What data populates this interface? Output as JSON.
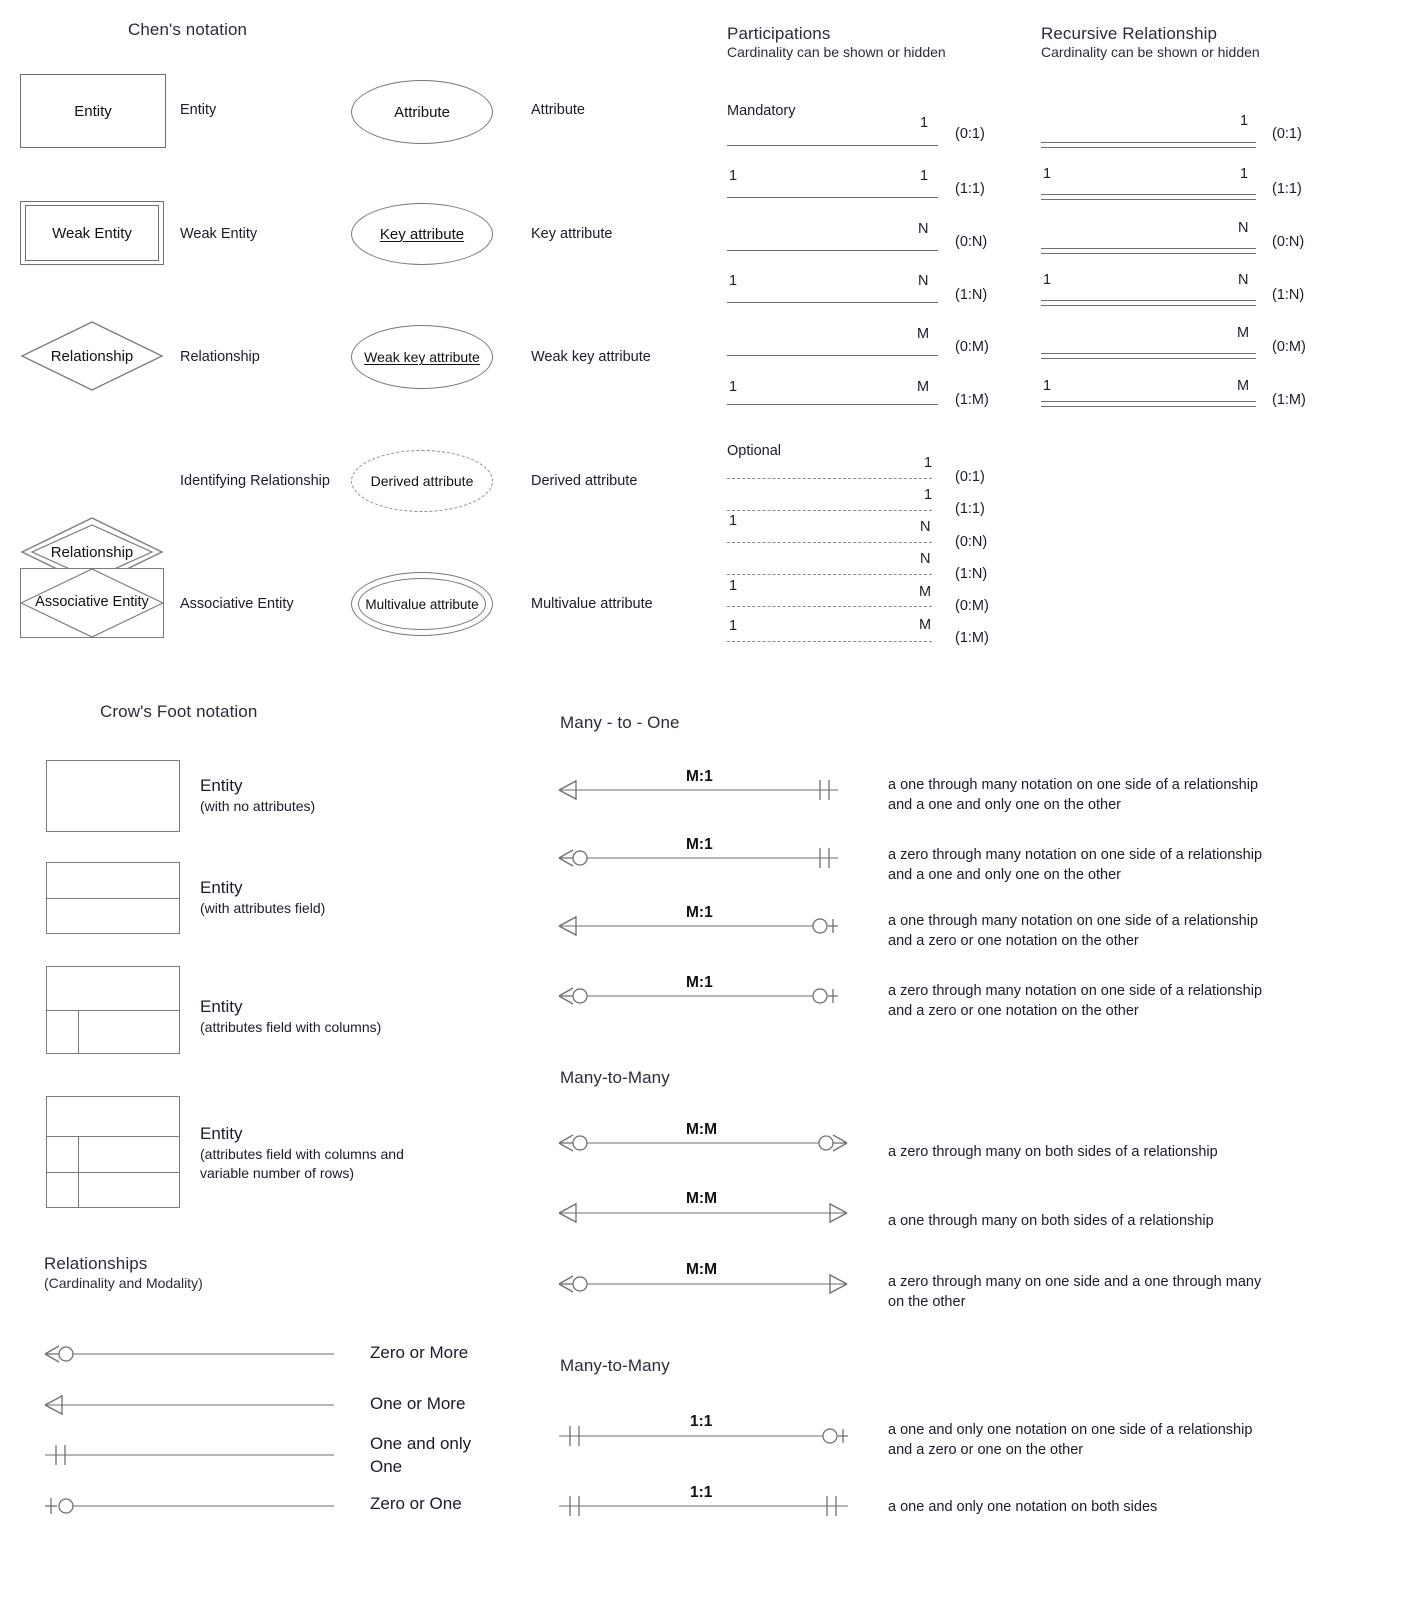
{
  "chen": {
    "title": "Chen's notation",
    "left_items": [
      {
        "shape": "rectangle",
        "shape_text": "Entity",
        "label": "Entity"
      },
      {
        "shape": "double-rectangle",
        "shape_text": "Weak Entity",
        "label": "Weak Entity"
      },
      {
        "shape": "diamond",
        "shape_text": "Relationship",
        "label": "Relationship"
      },
      {
        "shape": "double-diamond",
        "shape_text": "Relationship",
        "label": "Identifying Relationship"
      },
      {
        "shape": "diamond-in-rectangle",
        "shape_text": "Associative Entity",
        "label": "Associative Entity"
      }
    ],
    "right_items": [
      {
        "shape": "ellipse",
        "shape_text": "Attribute",
        "label": "Attribute",
        "underline": false
      },
      {
        "shape": "ellipse",
        "shape_text": "Key attribute",
        "label": "Key attribute",
        "underline": true
      },
      {
        "shape": "ellipse",
        "shape_text": "Weak key attribute",
        "label": "Weak key attribute",
        "underline": true
      },
      {
        "shape": "dashed-ellipse",
        "shape_text": "Derived attribute",
        "label": "Derived attribute",
        "underline": false
      },
      {
        "shape": "double-ellipse",
        "shape_text": "Multivalue attribute",
        "label": "Multivalue attribute",
        "underline": false
      }
    ]
  },
  "participations": {
    "title": "Participations",
    "subtitle": "Cardinality can be shown or hidden",
    "mandatory_label": "Mandatory",
    "optional_label": "Optional",
    "mandatory_rows": [
      {
        "left": "",
        "right": "1",
        "card": "(0:1)"
      },
      {
        "left": "1",
        "right": "1",
        "card": "(1:1)"
      },
      {
        "left": "",
        "right": "N",
        "card": "(0:N)"
      },
      {
        "left": "1",
        "right": "N",
        "card": "(1:N)"
      },
      {
        "left": "",
        "right": "M",
        "card": "(0:M)"
      },
      {
        "left": "1",
        "right": "M",
        "card": "(1:M)"
      }
    ],
    "optional_rows": [
      {
        "left": "",
        "right": "1",
        "card": "(0:1)"
      },
      {
        "left": "",
        "right": "1",
        "card": "(1:1)"
      },
      {
        "left": "1",
        "right": "N",
        "card": "(0:N)"
      },
      {
        "left": "",
        "right": "N",
        "card": "(1:N)"
      },
      {
        "left": "1",
        "right": "M",
        "card": "(0:M)"
      },
      {
        "left": "1",
        "right": "M",
        "card": "(1:M)"
      }
    ]
  },
  "recursive": {
    "title": "Recursive Relationship",
    "subtitle": "Cardinality can be shown or hidden",
    "rows": [
      {
        "left": "",
        "right": "1",
        "card": "(0:1)"
      },
      {
        "left": "1",
        "right": "1",
        "card": "(1:1)"
      },
      {
        "left": "",
        "right": "N",
        "card": "(0:N)"
      },
      {
        "left": "1",
        "right": "N",
        "card": "(1:N)"
      },
      {
        "left": "",
        "right": "M",
        "card": "(0:M)"
      },
      {
        "left": "1",
        "right": "M",
        "card": "(1:M)"
      }
    ]
  },
  "crowsfoot": {
    "title": "Crow's Foot notation",
    "entities": [
      {
        "name": "Entity",
        "detail": "(with no attributes)"
      },
      {
        "name": "Entity",
        "detail": "(with attributes field)"
      },
      {
        "name": "Entity",
        "detail": "(attributes field with columns)"
      },
      {
        "name": "Entity",
        "detail": "(attributes field with columns and\nvariable number of rows)"
      }
    ]
  },
  "relationships": {
    "title": "Relationships",
    "subtitle": "(Cardinality and Modality)",
    "items": [
      {
        "symbol": "crowfoot-circle",
        "label": "Zero or More"
      },
      {
        "symbol": "crowfoot-bar",
        "label": "One or More"
      },
      {
        "symbol": "double-bar",
        "label": "One and only\nOne"
      },
      {
        "symbol": "bar-circle",
        "label": "Zero or One"
      }
    ]
  },
  "many_to_one": {
    "title": "Many - to - One",
    "rows": [
      {
        "cardinality": "M:1",
        "left_symbol": "crowfoot-bar",
        "right_symbol": "double-bar",
        "description": "a one through many notation on one side of a relationship\nand a one and only one on the other"
      },
      {
        "cardinality": "M:1",
        "left_symbol": "crowfoot-circle",
        "right_symbol": "double-bar",
        "description": "a zero through many notation on one side of a relationship\nand a one and only one on the other"
      },
      {
        "cardinality": "M:1",
        "left_symbol": "crowfoot-bar",
        "right_symbol": "circle-bar",
        "description": "a one through many notation on one side of a relationship\nand a zero or one notation on the other"
      },
      {
        "cardinality": "M:1",
        "left_symbol": "crowfoot-circle",
        "right_symbol": "circle-bar",
        "description": "a zero through many notation on one side of a relationship\nand a zero or one notation on the other"
      }
    ]
  },
  "many_to_many": {
    "title": "Many-to-Many",
    "rows": [
      {
        "cardinality": "M:M",
        "left_symbol": "crowfoot-circle",
        "right_symbol": "circle-crowfoot",
        "description": "a zero through many on both sides of a relationship"
      },
      {
        "cardinality": "M:M",
        "left_symbol": "crowfoot-bar",
        "right_symbol": "bar-crowfoot",
        "description": "a one through many on both sides of a relationship"
      },
      {
        "cardinality": "M:M",
        "left_symbol": "crowfoot-circle",
        "right_symbol": "bar-crowfoot",
        "description": "a zero through many on one side and a one through many\non the other"
      }
    ]
  },
  "one_to_one": {
    "title": "Many-to-Many",
    "rows": [
      {
        "cardinality": "1:1",
        "left_symbol": "double-bar",
        "right_symbol": "circle-bar",
        "description": "a one and only one notation on one side of a relationship\nand a zero or one on the other"
      },
      {
        "cardinality": "1:1",
        "left_symbol": "double-bar",
        "right_symbol": "double-bar",
        "description": "a one and only one notation on both sides"
      }
    ]
  },
  "colors": {
    "stroke": "#6f6f6f",
    "text": "#1b1b2b",
    "background": "#ffffff"
  }
}
